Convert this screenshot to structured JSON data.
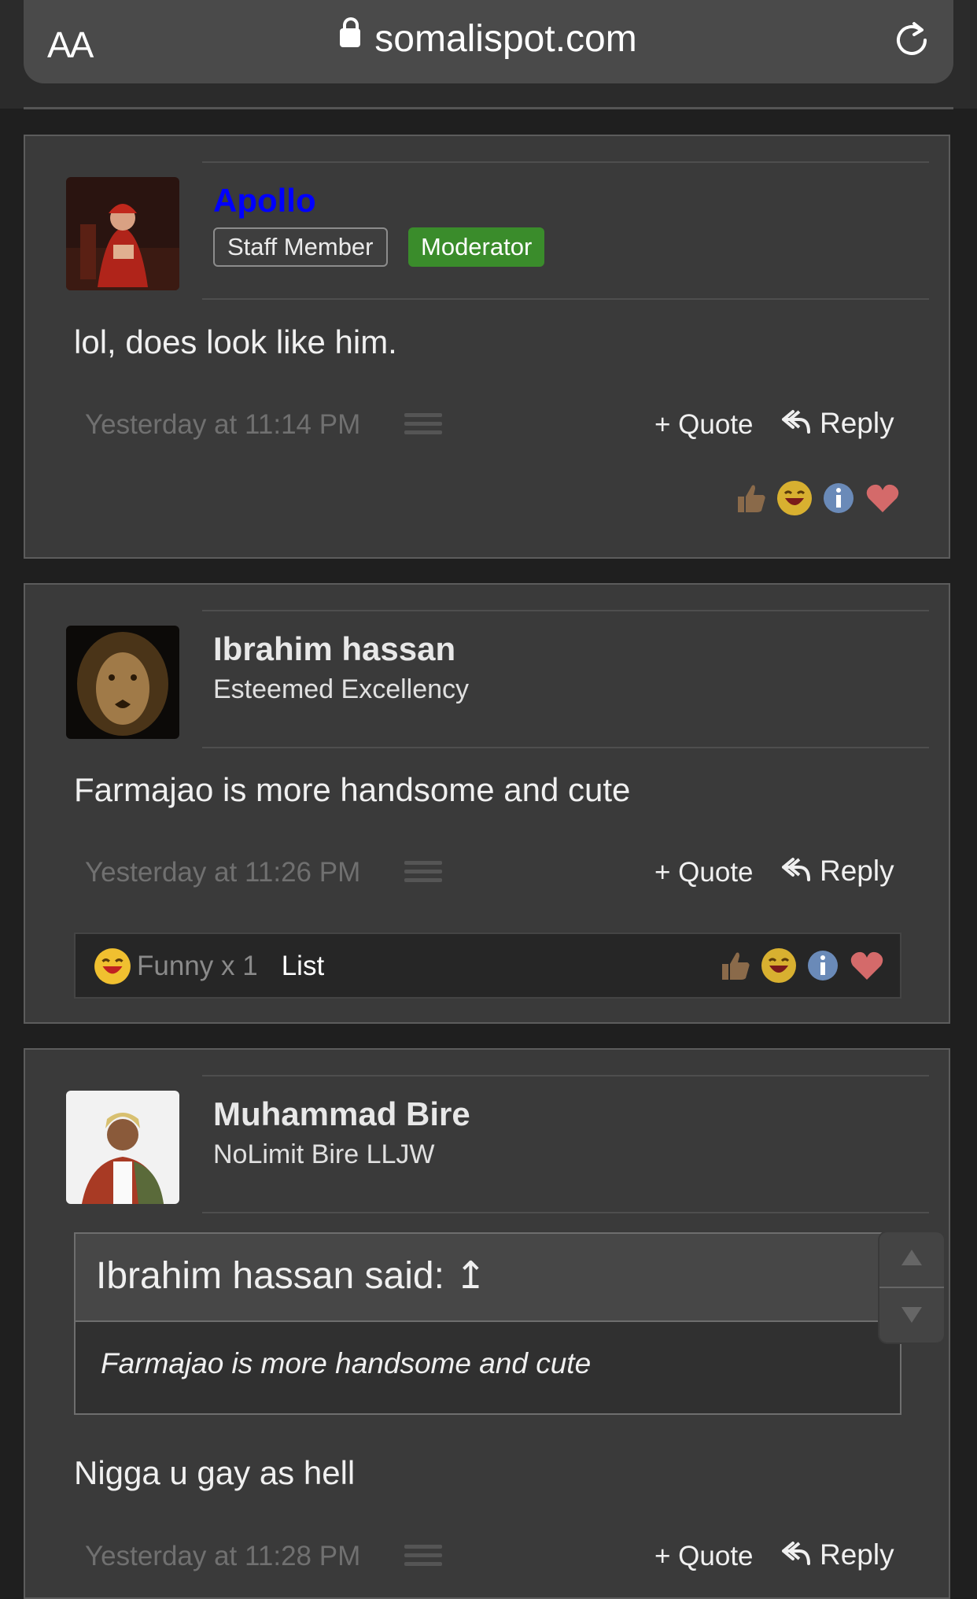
{
  "browser": {
    "text_size_label": "AA",
    "domain": "somalispot.com"
  },
  "posts": [
    {
      "username": "Apollo",
      "badges": [
        "Staff Member",
        "Moderator"
      ],
      "message": "lol, does look like him.",
      "timestamp": "Yesterday at 11:14 PM",
      "quote_label": "+ Quote",
      "reply_label": "Reply"
    },
    {
      "username": "Ibrahim hassan",
      "user_title": "Esteemed Excellency",
      "message": "Farmajao is more handsome and cute",
      "timestamp": "Yesterday at 11:26 PM",
      "quote_label": "+ Quote",
      "reply_label": "Reply",
      "reaction_summary": {
        "label": "Funny x 1",
        "list_label": "List"
      }
    },
    {
      "username": "Muhammad Bire",
      "user_title": "NoLimit Bire LLJW",
      "quoted": {
        "header": "Ibrahim hassan said: ↥",
        "text": "Farmajao is more handsome and cute"
      },
      "message": "Nigga u gay as hell",
      "timestamp": "Yesterday at 11:28 PM",
      "quote_label": "+ Quote",
      "reply_label": "Reply"
    }
  ],
  "reaction_icons": [
    "thumbs-up-icon",
    "laugh-icon",
    "info-icon",
    "heart-icon"
  ],
  "colors": {
    "moderator_name": "#0000ff",
    "moderator_badge": "#3a8c2b",
    "post_bg": "#3a3a3a"
  }
}
